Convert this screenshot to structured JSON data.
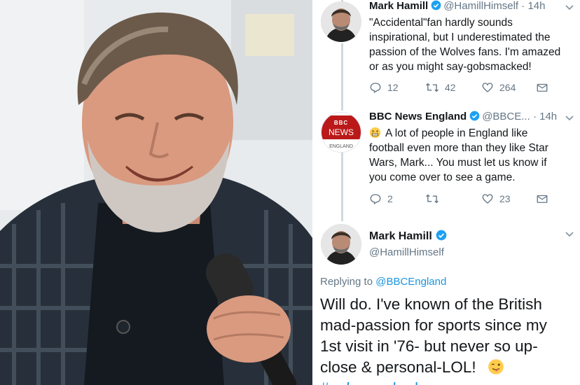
{
  "photo": {
    "description_icon": "person-photo"
  },
  "tweets": [
    {
      "name": "Mark Hamill",
      "handle": "@HamillHimself",
      "dot": "·",
      "time": "14h",
      "text_lines": [
        "\"Accidental\"fan hardly sounds",
        "inspirational, but I underestimated the",
        "passion of the Wolves fans. I'm amazed",
        "or as you might say-gobsmacked!"
      ],
      "replies": "12",
      "retweets": "42",
      "likes": "264"
    },
    {
      "name": "BBC News England",
      "handle": "@BBCE...",
      "dot": "·",
      "time": "14h",
      "logo_top": "BBC",
      "logo_mid": "NEWS",
      "logo_bottom": "ENGLAND",
      "text_lines": [
        "A lot of people in England like",
        "football even more than they like Star",
        "Wars, Mark... You must let us know if",
        "you come over to see a game."
      ],
      "replies": "2",
      "retweets": "",
      "likes": "23"
    }
  ],
  "main_tweet": {
    "name": "Mark Hamill",
    "handle": "@HamillHimself",
    "replying_prefix": "Replying to",
    "replying_to": "@BBCEngland",
    "text_lines": [
      "Will do. I've known of the British",
      "mad-passion for sports since my",
      "1st visit in '76- but never so up-",
      "close & personal-LOL!"
    ],
    "hashtag": "#gobsmacked"
  },
  "colors": {
    "accent": "#1b95e0",
    "muted": "#657786",
    "bbc_red": "#bb1919"
  }
}
